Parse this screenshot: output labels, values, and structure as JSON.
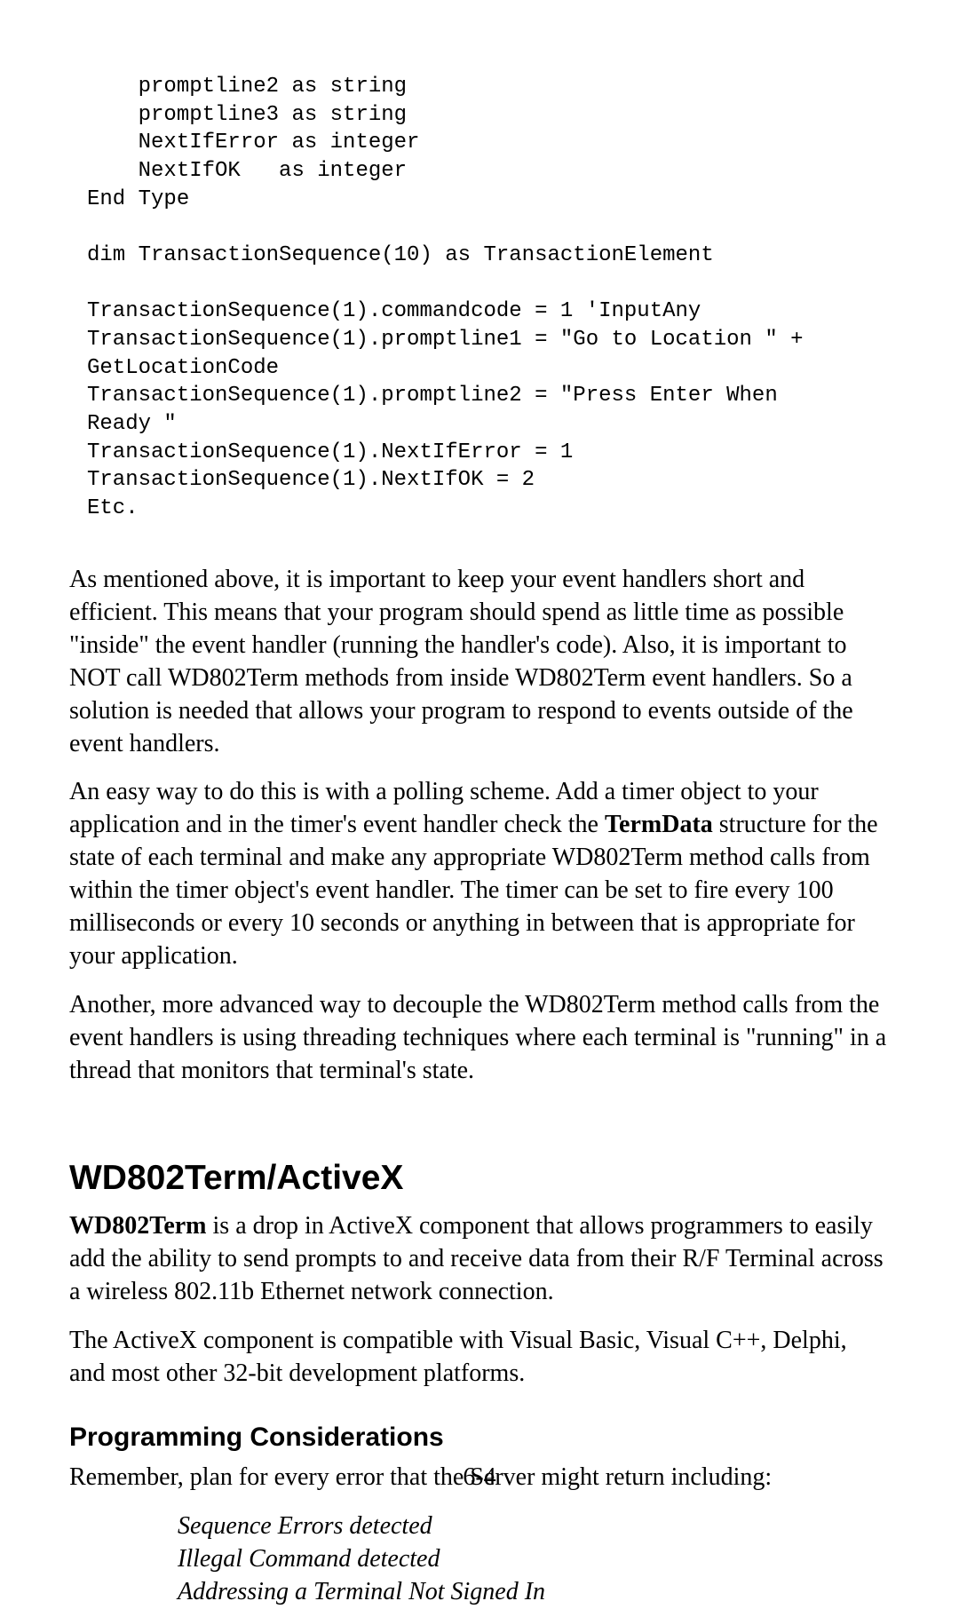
{
  "code": "    promptline2 as string\n    promptline3 as string\n    NextIfError as integer\n    NextIfOK   as integer\nEnd Type\n\ndim TransactionSequence(10) as TransactionElement\n\nTransactionSequence(1).commandcode = 1 'InputAny\nTransactionSequence(1).promptline1 = \"Go to Location \" +\nGetLocationCode\nTransactionSequence(1).promptline2 = \"Press Enter When\nReady \"\nTransactionSequence(1).NextIfError = 1\nTransactionSequence(1).NextIfOK = 2\nEtc.",
  "p1": "As mentioned above, it is important to keep your event handlers short and efficient. This means that your program should spend as little time as possible \"inside\" the event handler (running the handler's code). Also, it is important to NOT call WD802Term methods from inside WD802Term event handlers. So a solution is needed that allows your program to respond to events outside of the event handlers.",
  "p2_pre": "An easy way to do this is to with a polling scheme. Add a timer object to your application and in the timer's event handler check the ",
  "p2_bold": "TermData",
  "p2_post": " structure for the state of each terminal and make any appropriate WD802Term method calls from within the timer object's event handler. The timer can be set to fire every 100 milliseconds or every 10 seconds or anything in between that is appropriate for your application.",
  "p2_pre_fixed": "An easy way to do this is with a polling scheme. Add a timer object to your application and in the timer's event handler check the ",
  "p3": "Another, more advanced way to decouple the WD802Term method calls from the event handlers is using threading techniques where each terminal is \"running\" in a thread that monitors that terminal's state.",
  "h2": "WD802Term/ActiveX",
  "p4_bold": "WD802Term",
  "p4_post": " is a drop in ActiveX component that allows programmers to easily add the ability to send prompts to and receive data from their R/F Terminal across a wireless 802.11b Ethernet network connection.",
  "p5": "The ActiveX component is compatible with Visual Basic, Visual C++, Delphi, and most other 32-bit development platforms.",
  "h3": "Programming Considerations",
  "p6": "Remember, plan for every error that the Server might return including:",
  "err1": "Sequence Errors detected",
  "err2": "Illegal Command detected",
  "err3": "Addressing a Terminal Not Signed In",
  "pagenum": "6-4"
}
